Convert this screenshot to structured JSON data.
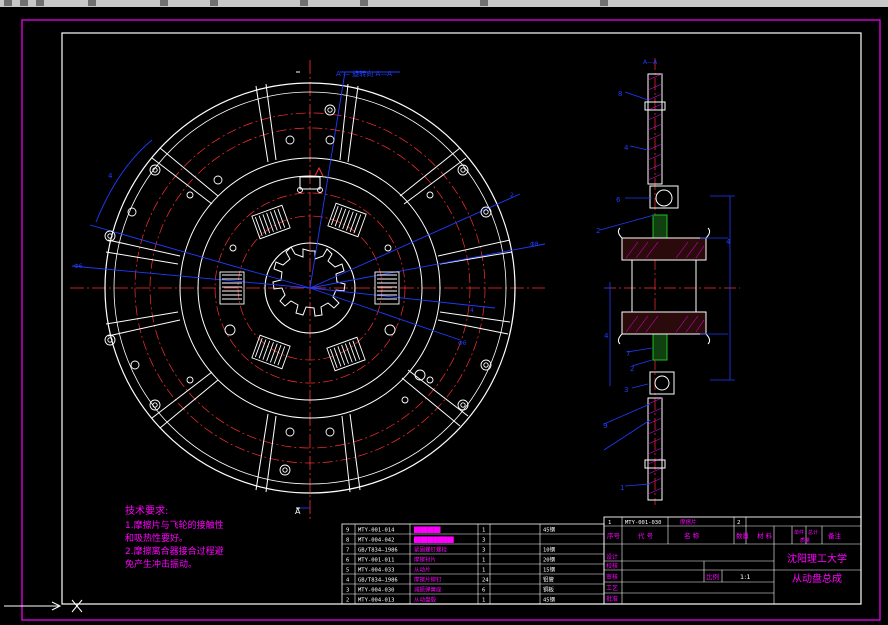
{
  "app": {
    "toolbar_icons": [
      "new-icon",
      "open-icon",
      "save-icon",
      "print-icon",
      "undo-icon",
      "redo-icon",
      "pan-icon",
      "zoom-icon",
      "properties-icon",
      "layer-icon"
    ]
  },
  "drawing": {
    "section_label": "A—A",
    "top_marker": "A — 旋转向 A—A",
    "bottom_marker": "A",
    "dim_labels": [
      "4",
      "4",
      "Φ6",
      "Φ8",
      "2",
      "4",
      "Φ6"
    ],
    "side_callouts": [
      "8",
      "4",
      "6",
      "2",
      "7",
      "2",
      "3",
      "9",
      "1"
    ],
    "tech_title": "技术要求:",
    "tech_lines": [
      "1.摩擦片与飞轮的接触性",
      "和吸热性要好。",
      "2.摩擦离合器接合过程避",
      "免产生冲击振动。"
    ]
  },
  "colors": {
    "white": "#ffffff",
    "red": "#ff3030",
    "blue": "#1e3cff",
    "magenta": "#ff00ff",
    "green": "#20c020",
    "yellow": "#ffff40"
  },
  "bom": {
    "rows": [
      {
        "no": "9",
        "code": "MTY-001-014",
        "name": "████████",
        "qty": "1",
        "mat": "45钢"
      },
      {
        "no": "8",
        "code": "MTY-004-042",
        "name": "████████████",
        "qty": "3",
        "mat": ""
      },
      {
        "no": "7",
        "code": "GB/T834—1986",
        "name": "紧固螺钉螺栓",
        "qty": "3",
        "mat": "10钢"
      },
      {
        "no": "6",
        "code": "MTY-001-011",
        "name": "摩擦衬片",
        "qty": "1",
        "mat": "20钢"
      },
      {
        "no": "5",
        "code": "MTY-004-033",
        "name": "从动片",
        "qty": "1",
        "mat": "15钢"
      },
      {
        "no": "4",
        "code": "GB/T834—1986",
        "name": "摩擦片铆钉",
        "qty": "24",
        "mat": "铝管"
      },
      {
        "no": "3",
        "code": "MTY-004-030",
        "name": "减振弹簧座",
        "qty": "6",
        "mat": "铜板"
      },
      {
        "no": "2",
        "code": "MTY-004-013",
        "name": "从动盘毂",
        "qty": "1",
        "mat": "45钢"
      }
    ],
    "title_row": {
      "no": "1",
      "code": "MTY-001-030",
      "name": "摩擦片",
      "qty": "2"
    },
    "header": [
      "序号",
      "代 号",
      "名 称",
      "数量",
      "材 料",
      "单件",
      "总计",
      "备注"
    ],
    "header_sub": "质量",
    "sign_labels": [
      "设计",
      "校核",
      "审核",
      "工艺",
      "批准"
    ],
    "scale_label": "比例",
    "scale": "1:1",
    "school": "沈阳理工大学",
    "drawing_title": "从动盘总成"
  }
}
